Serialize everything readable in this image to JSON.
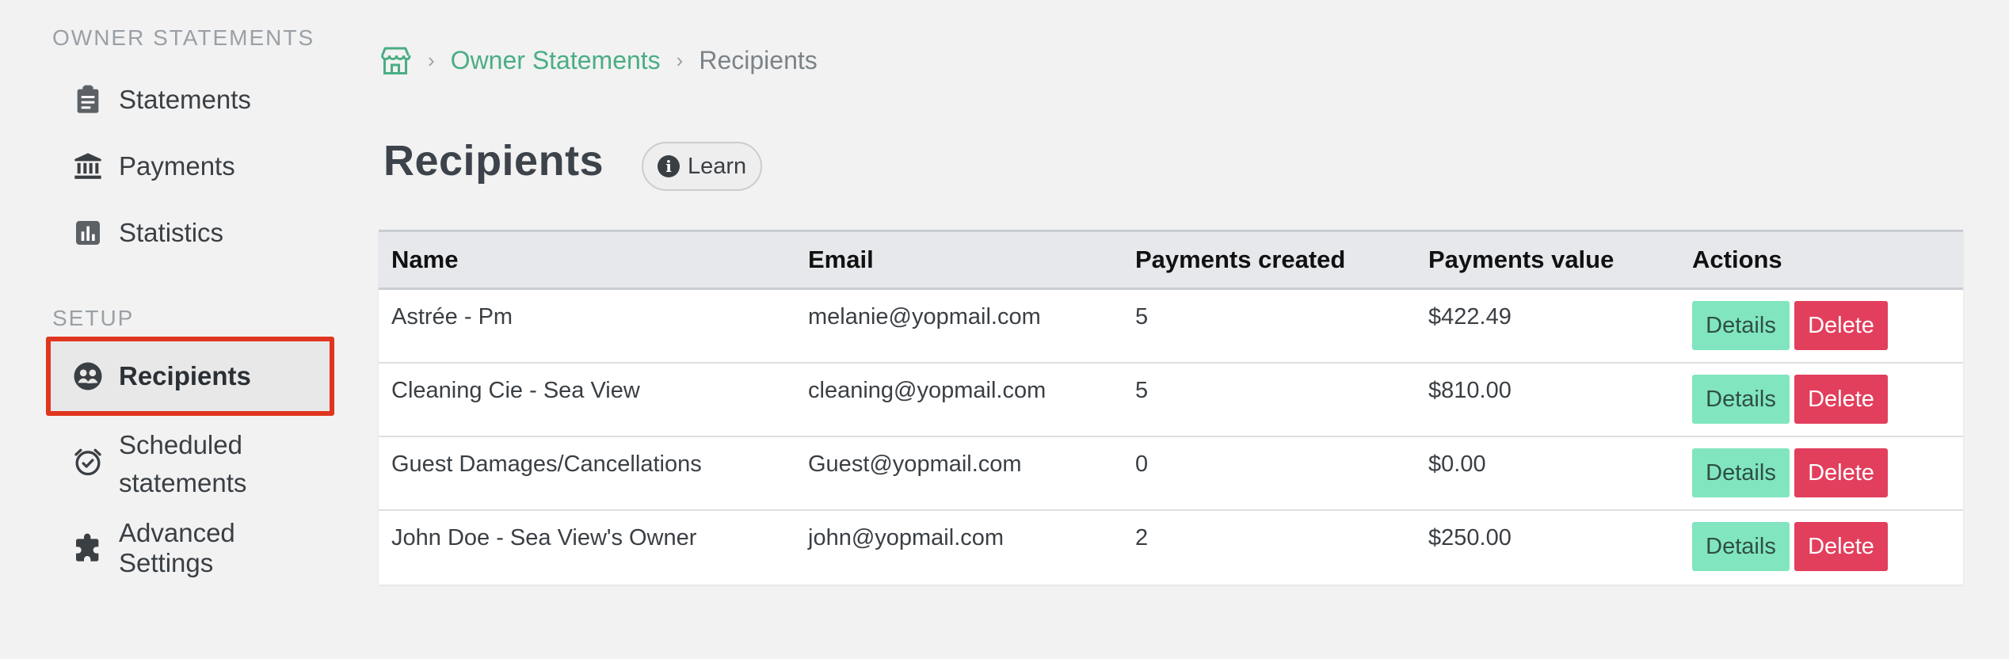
{
  "sidebar": {
    "owner_section_title": "OWNER STATEMENTS",
    "setup_section_title": "SETUP",
    "items": [
      {
        "label": "Statements",
        "icon": "clipboard-icon"
      },
      {
        "label": "Payments",
        "icon": "bank-icon"
      },
      {
        "label": "Statistics",
        "icon": "bar-chart-icon"
      },
      {
        "label": "Recipients",
        "icon": "recipients-icon",
        "active": true
      },
      {
        "label": "Scheduled statements",
        "icon": "alarm-clock-icon"
      },
      {
        "label": "Advanced Settings",
        "icon": "puzzle-icon"
      }
    ],
    "active_outline_color": "#e0351f"
  },
  "breadcrumb": {
    "home_icon": "store-icon",
    "parent": "Owner Statements",
    "current": "Recipients"
  },
  "page": {
    "title": "Recipients",
    "learn_label": "Learn"
  },
  "table": {
    "headers": [
      "Name",
      "Email",
      "Payments created",
      "Payments value",
      "Actions"
    ],
    "rows": [
      {
        "name": "Astrée - Pm",
        "email": "melanie@yopmail.com",
        "payments_created": "5",
        "payments_value": "$422.49"
      },
      {
        "name": "Cleaning Cie - Sea View",
        "email": "cleaning@yopmail.com",
        "payments_created": "5",
        "payments_value": "$810.00"
      },
      {
        "name": "Guest Damages/Cancellations",
        "email": "Guest@yopmail.com",
        "payments_created": "0",
        "payments_value": "$0.00"
      },
      {
        "name": "John Doe - Sea View's Owner",
        "email": "john@yopmail.com",
        "payments_created": "2",
        "payments_value": "$250.00"
      }
    ],
    "details_label": "Details",
    "delete_label": "Delete"
  },
  "colors": {
    "accent_green": "#4aae84",
    "details_button": "#81e6bf",
    "delete_button": "#e23f5d"
  }
}
